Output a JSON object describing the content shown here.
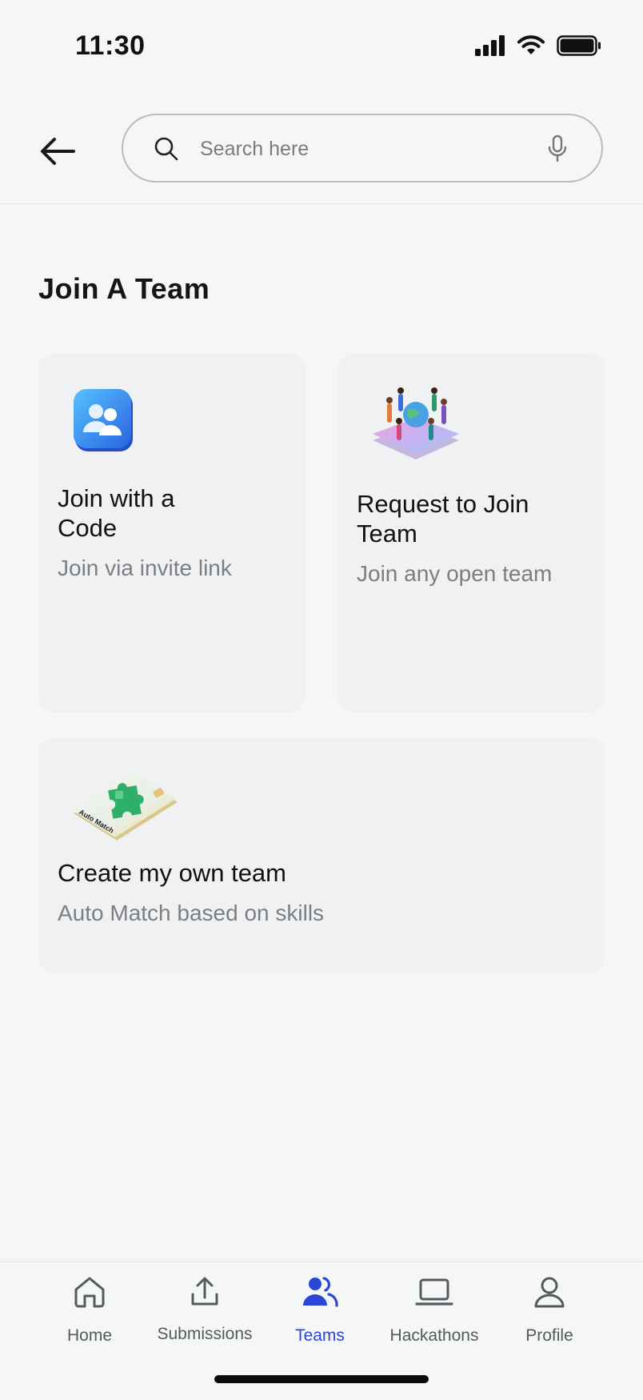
{
  "status_bar": {
    "time": "11:30"
  },
  "search": {
    "placeholder": "Search here"
  },
  "page": {
    "title": "Join A Team"
  },
  "cards": [
    {
      "title_line1": "Join with a",
      "title_line2": "Code",
      "subtitle": "Join via invite link",
      "icon": "team-badge-icon"
    },
    {
      "title_line1": "Request to Join",
      "title_line2": "Team",
      "subtitle": "Join any open team",
      "icon": "globe-people-icon"
    },
    {
      "title": "Create my own team",
      "subtitle": "Auto Match based on skills",
      "icon": "auto-match-card-icon",
      "icon_text": "Auto Match"
    }
  ],
  "nav": {
    "items": [
      {
        "label": "Home",
        "icon": "home-icon"
      },
      {
        "label": "Submissions",
        "icon": "upload-icon"
      },
      {
        "label": "Teams",
        "icon": "teams-icon",
        "active": true
      },
      {
        "label": "Hackathons",
        "icon": "laptop-icon"
      },
      {
        "label": "Profile",
        "icon": "profile-icon"
      }
    ]
  },
  "colors": {
    "accent": "#2a47d8",
    "background": "#f5f6f6",
    "card": "#eff1f3",
    "muted_text": "#7c7f82"
  }
}
